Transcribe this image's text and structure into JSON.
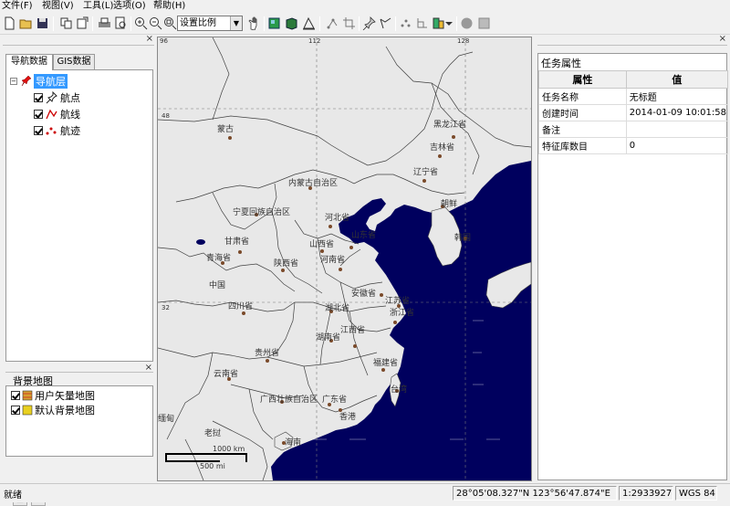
{
  "menu": [
    "文件(F)",
    "视图(V)",
    "工具(L)",
    "选项(O)",
    "帮助(H)"
  ],
  "toolbar": {
    "scale_select": "设置比例",
    "icons": [
      "new-icon",
      "open-icon",
      "save-icon",
      "copy-icon",
      "export-icon",
      "print-icon",
      "print-preview-icon",
      "zoom-in-icon",
      "zoom-out-icon",
      "zoom-fit-icon",
      "pan-hand-icon",
      "layer-icon",
      "package-icon",
      "measure-icon",
      "pin-icon",
      "route-icon",
      "node-icon",
      "crop-icon",
      "settings-icon",
      "circle-icon",
      "stop-icon"
    ]
  },
  "left_panel": {
    "tabs": [
      "导航数据",
      "GIS数据"
    ],
    "tree_root": "导航层",
    "tree_items": [
      "航点",
      "航线",
      "航迹"
    ],
    "bg_title": "背景地图",
    "bg_items": [
      "用户矢量地图",
      "默认背景地图"
    ]
  },
  "map": {
    "lon_ticks": [
      "96",
      "112",
      "128"
    ],
    "lat_ticks": [
      "48",
      "32"
    ],
    "labels": [
      "蒙古",
      "黑龙江省",
      "吉林省",
      "辽宁省",
      "内蒙古自治区",
      "宁夏回族自治区",
      "河北省",
      "朝鲜",
      "甘肃省",
      "山西省",
      "山东省",
      "韩国",
      "青海省",
      "陕西省",
      "河南省",
      "中国",
      "安徽省",
      "四川省",
      "湖北省",
      "江苏省",
      "浙江省",
      "湖南省",
      "江西省",
      "贵州省",
      "福建省",
      "云南省",
      "台湾",
      "广西壮族自治区",
      "广东省",
      "香港",
      "缅甸",
      "老挝",
      "海南"
    ],
    "scale_km": "1000 km",
    "scale_mi": "500 mi"
  },
  "right_panel": {
    "title": "任务属性",
    "col_property": "属性",
    "col_value": "值",
    "rows": [
      {
        "k": "任务名称",
        "v": "无标题"
      },
      {
        "k": "创建时间",
        "v": "2014-01-09 10:01:58"
      },
      {
        "k": "备注",
        "v": ""
      },
      {
        "k": "特征库数目",
        "v": "0"
      }
    ]
  },
  "status": {
    "ready": "就绪",
    "coords": "28°05'08.327\"N 123°56'47.874\"E",
    "scale": "1:29339278",
    "datum": "WGS 84"
  },
  "colors": {
    "sea": "#00005e",
    "land": "#e8e8e8",
    "border": "#404040"
  }
}
